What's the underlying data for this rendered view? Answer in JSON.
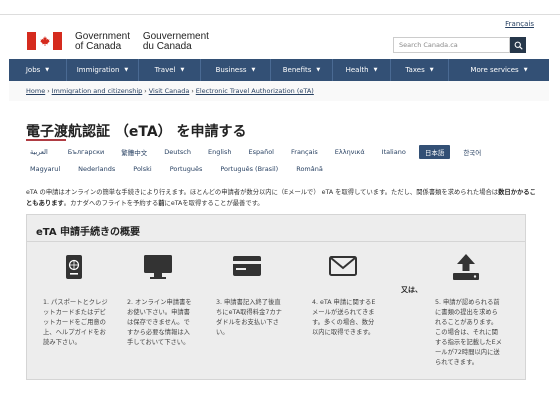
{
  "language_toggle": "Français",
  "fip": {
    "en_line1": "Government",
    "en_line2": "of Canada",
    "fr_line1": "Gouvernement",
    "fr_line2": "du Canada"
  },
  "search": {
    "placeholder": "Search Canada.ca"
  },
  "menu": [
    {
      "label": "Jobs",
      "width": 58
    },
    {
      "label": "Immigration",
      "width": 72
    },
    {
      "label": "Travel",
      "width": 62
    },
    {
      "label": "Business",
      "width": 70
    },
    {
      "label": "Benefits",
      "width": 62
    },
    {
      "label": "Health",
      "width": 58
    },
    {
      "label": "Taxes",
      "width": 58
    },
    {
      "label": "More services",
      "width": 100
    }
  ],
  "breadcrumb": [
    "Home",
    "Immigration and citizenship",
    "Visit Canada",
    "Electronic Travel Authorization (eTA)"
  ],
  "page_title": "電子渡航認証 （eTA） を申請する",
  "languages_row1": [
    {
      "label": "العربية",
      "gap": 0
    },
    {
      "label": "Български",
      "gap": 20
    },
    {
      "label": "繁體中文",
      "gap": 17
    },
    {
      "label": "Deutsch",
      "gap": 17
    },
    {
      "label": "English",
      "gap": 17
    },
    {
      "label": "Español",
      "gap": 17
    },
    {
      "label": "Français",
      "gap": 17
    },
    {
      "label": "Ελληνικά",
      "gap": 17
    },
    {
      "label": "Italiano",
      "gap": 17
    },
    {
      "label": "日本語",
      "gap": 13,
      "active": true
    },
    {
      "label": "한국어",
      "gap": 13
    }
  ],
  "languages_row2": [
    {
      "label": "Magyarul",
      "gap": 0
    },
    {
      "label": "Nederlands",
      "gap": 18
    },
    {
      "label": "Polski",
      "gap": 18
    },
    {
      "label": "Português",
      "gap": 18
    },
    {
      "label": "Português (Brasil)",
      "gap": 18
    },
    {
      "label": "Română",
      "gap": 18
    }
  ],
  "intro": {
    "part1": "eTA の申請はオンラインの簡単な手続きにより行えます。ほとんどの申請者が数分以内に（Eメールで） eTA を取得しています。ただし、関係書類を求められた場合は",
    "bold": "数日かかることもあります",
    "part2": "。カナダへのフライトを予約する",
    "part3": "前",
    "part4": "にeTAを取得することが最善です。"
  },
  "steps_panel": {
    "title": "eTA 申請手続きの概要",
    "or_label": "又は、",
    "steps": [
      {
        "icon": "passport-icon",
        "text": "1. パスポートとクレジットカードまたはデビットカードをご用意の上、ヘルプガイドをお読み下さい。"
      },
      {
        "icon": "monitor-icon",
        "text": "2. オンライン申請書をお使い下さい。申請書は保存できません。ですから必要な情報は入手しておいて下さい。"
      },
      {
        "icon": "credit-card-icon",
        "text": "3. 申請書記入終了後直ちにeTA取得料金7カナダドルをお支払い下さい。"
      },
      {
        "icon": "envelope-icon",
        "text": "4. eTA 申請に関するEメールが送られてきます。多くの場合、数分以内に取得できます。"
      },
      {
        "icon": "upload-icon",
        "text": "5. 申請が認められる前に書類の提出を求められることがあります。この場合は、それに関する指示を記載したEメールが72時間以内に送られてきます。"
      }
    ]
  },
  "colors": {
    "menu_bg": "#335075",
    "active_lang": "#335075",
    "link": "#284162",
    "title_rule": "#af3c43",
    "flag_red": "#d52b1e",
    "panel_bg": "#ededed"
  }
}
